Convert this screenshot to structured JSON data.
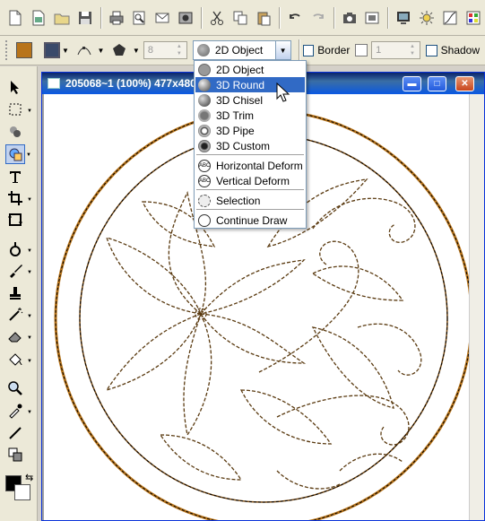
{
  "toolbar": {
    "icons": [
      "new-file-icon",
      "open-file-icon",
      "open-folder-icon",
      "save-icon",
      "print-icon",
      "print-preview-icon",
      "email-icon",
      "camera-icon",
      "cut-icon",
      "copy-icon",
      "paste-icon",
      "undo-icon",
      "redo-icon",
      "capture-icon",
      "scan-icon",
      "monitor-icon",
      "brightness-icon",
      "curve-icon",
      "color-palette-icon"
    ]
  },
  "properties": {
    "outline_width": "8",
    "object_type": "2D Object",
    "border_label": "Border",
    "border_width": "1",
    "shadow_label": "Shadow"
  },
  "dropdown": {
    "items": [
      {
        "label": "2D Object",
        "icon": "2d-object-icon"
      },
      {
        "label": "3D Round",
        "icon": "3d-round-icon",
        "selected": true
      },
      {
        "label": "3D Chisel",
        "icon": "3d-chisel-icon"
      },
      {
        "label": "3D Trim",
        "icon": "3d-trim-icon"
      },
      {
        "label": "3D Pipe",
        "icon": "3d-pipe-icon"
      },
      {
        "label": "3D Custom",
        "icon": "3d-custom-icon"
      },
      {
        "label": "Horizontal Deform",
        "icon": "horizontal-deform-icon"
      },
      {
        "label": "Vertical Deform",
        "icon": "vertical-deform-icon"
      },
      {
        "label": "Selection",
        "icon": "selection-icon"
      },
      {
        "label": "Continue Draw",
        "icon": "continue-draw-icon"
      }
    ]
  },
  "document": {
    "title": "205068~1 (100%) 477x480"
  },
  "tools": [
    "pointer",
    "lasso",
    "paint",
    "shape",
    "text",
    "crop",
    "transform",
    "dodge",
    "brush",
    "stamp",
    "wand",
    "eraser",
    "fill",
    "zoom",
    "eyedropper",
    "line",
    "clone"
  ],
  "colors": {
    "foreground": "#000000",
    "background": "#ffffff",
    "accent": "#316ac5",
    "ring": "#b8741a"
  }
}
